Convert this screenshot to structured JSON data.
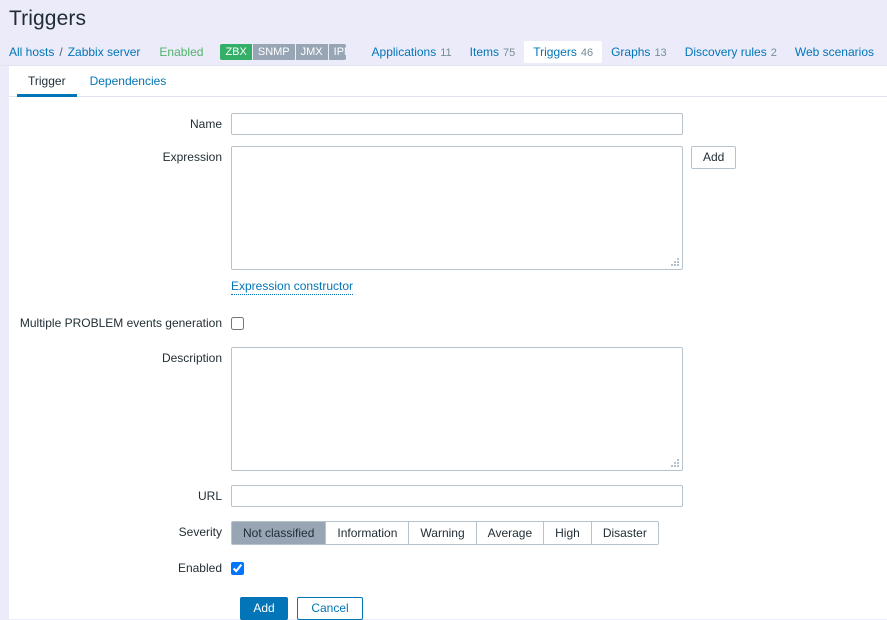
{
  "header": {
    "title": "Triggers"
  },
  "breadcrumb": {
    "all_hosts_label": "All hosts",
    "separator": "/",
    "host_label": "Zabbix server",
    "status_label": "Enabled",
    "interfaces": [
      {
        "label": "ZBX",
        "active": true
      },
      {
        "label": "SNMP",
        "active": false
      },
      {
        "label": "JMX",
        "active": false
      },
      {
        "label": "IPMI",
        "active": false
      }
    ],
    "nav_tabs": [
      {
        "label": "Applications",
        "count": "11",
        "active": false
      },
      {
        "label": "Items",
        "count": "75",
        "active": false
      },
      {
        "label": "Triggers",
        "count": "46",
        "active": true
      },
      {
        "label": "Graphs",
        "count": "13",
        "active": false
      },
      {
        "label": "Discovery rules",
        "count": "2",
        "active": false
      },
      {
        "label": "Web scenarios",
        "count": "",
        "active": false
      }
    ]
  },
  "sub_tabs": [
    {
      "label": "Trigger",
      "active": true
    },
    {
      "label": "Dependencies",
      "active": false
    }
  ],
  "form": {
    "name": {
      "label": "Name",
      "value": "",
      "placeholder": ""
    },
    "expression": {
      "label": "Expression",
      "value": "",
      "placeholder": "",
      "add_button_label": "Add",
      "constructor_link_label": "Expression constructor"
    },
    "multiple_problem": {
      "label": "Multiple PROBLEM events generation",
      "checked": false
    },
    "description": {
      "label": "Description",
      "value": "",
      "placeholder": ""
    },
    "url": {
      "label": "URL",
      "value": "",
      "placeholder": ""
    },
    "severity": {
      "label": "Severity",
      "selected": "Not classified",
      "options": [
        "Not classified",
        "Information",
        "Warning",
        "Average",
        "High",
        "Disaster"
      ]
    },
    "enabled": {
      "label": "Enabled",
      "checked": true
    },
    "actions": {
      "submit_label": "Add",
      "cancel_label": "Cancel"
    }
  },
  "colors": {
    "page_background": "#ebebfa",
    "panel_background": "#ffffff",
    "link": "#0275b8",
    "status_enabled": "#51b36c",
    "interface_active": "#34af67",
    "interface_inactive": "#97a5b5",
    "severity_selected": "#97a5b5",
    "primary_button": "#0275b8",
    "border": "#b6c3cd"
  }
}
